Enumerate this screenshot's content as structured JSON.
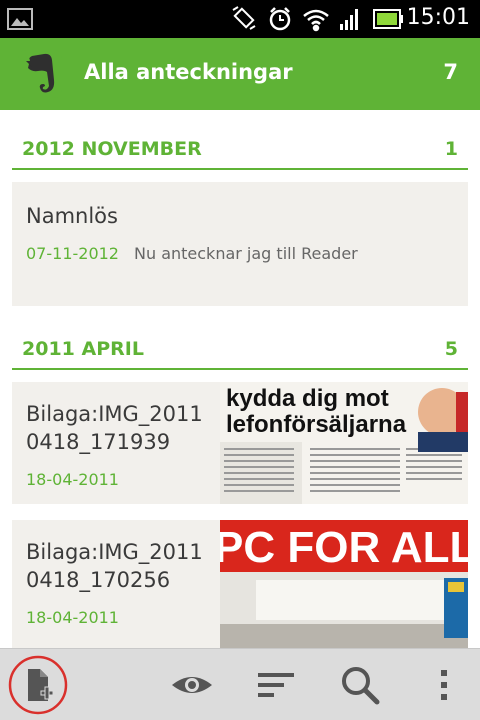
{
  "status_bar": {
    "time": "15:01"
  },
  "action_bar": {
    "title": "Alla anteckningar",
    "count": "7"
  },
  "sections": [
    {
      "label": "2012 NOVEMBER",
      "count": "1"
    },
    {
      "label": "2011 APRIL",
      "count": "5"
    }
  ],
  "notes": [
    {
      "title": "Namnlös",
      "date": "07-11-2012",
      "snippet": "Nu antecknar jag till Reader"
    },
    {
      "title_line1": "Bilaga:IMG_2011",
      "title_line2": "0418_171939",
      "date": "18-04-2011",
      "thumb_text_1": "kydda dig mot",
      "thumb_text_2": "lefonförsäljarna"
    },
    {
      "title_line1": "Bilaga:IMG_2011",
      "title_line2": "0418_170256",
      "date": "18-04-2011",
      "thumb_text_1": "PC FOR ALLA"
    }
  ],
  "colors": {
    "accent": "#5fb336",
    "card_bg": "#f2f0ec",
    "bottom_bar": "#dcdcdc",
    "highlight_circle": "#d9302c"
  }
}
